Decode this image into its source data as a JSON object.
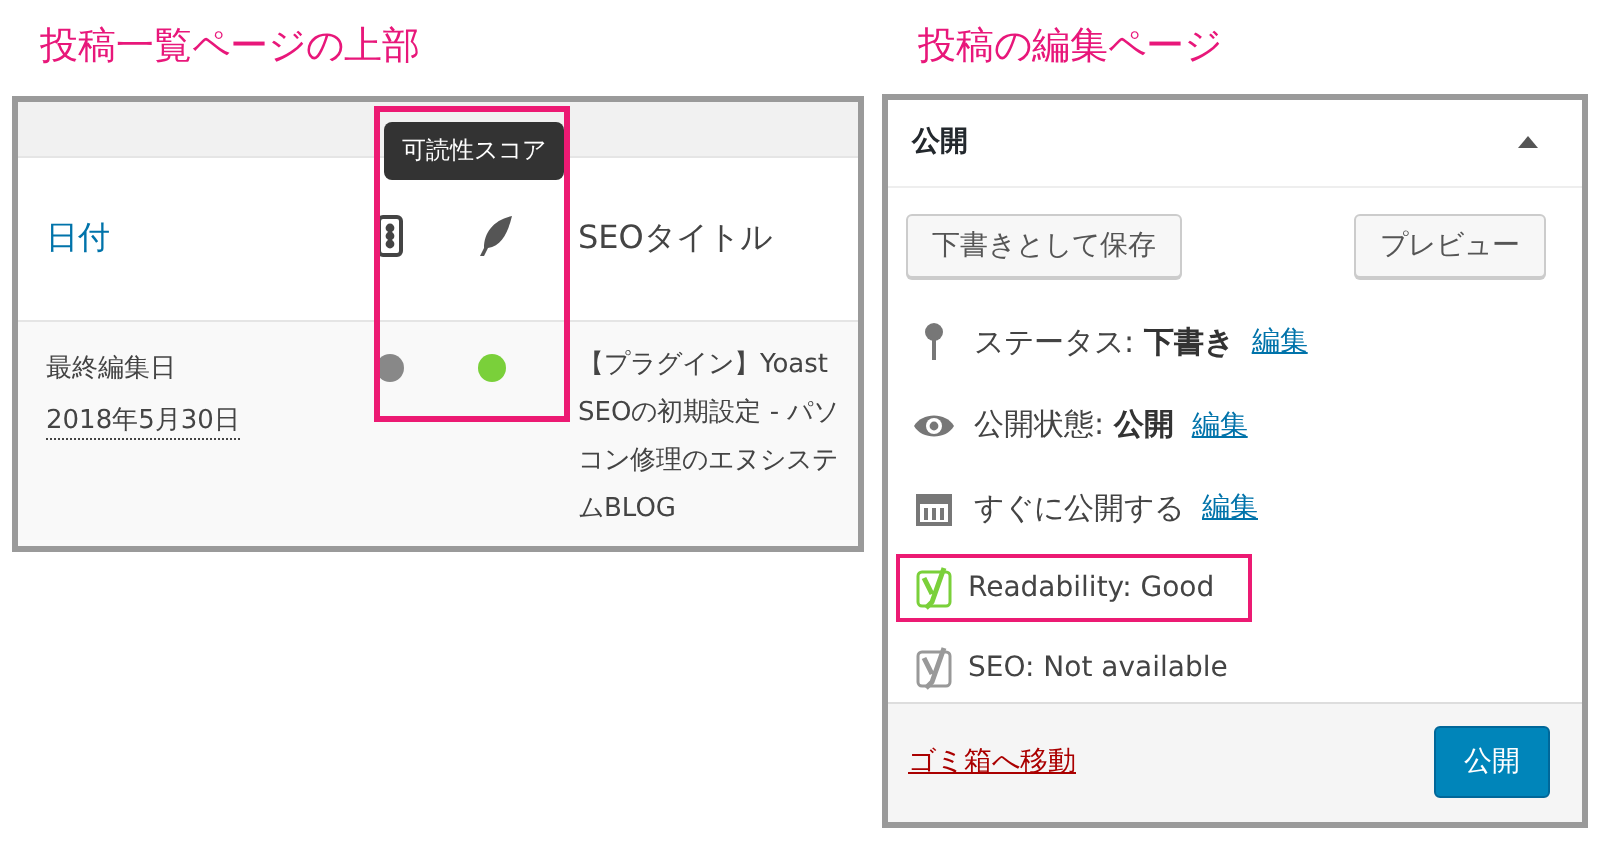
{
  "captions": [
    "投稿一覧ページの上部",
    "投稿の編集ページ"
  ],
  "post_list": {
    "tooltip": "可読性スコア",
    "columns": [
      {
        "kind": "text",
        "label": "日付"
      },
      {
        "kind": "seo-icon"
      },
      {
        "kind": "readability-icon"
      },
      {
        "kind": "text",
        "label": "SEOタイトル"
      }
    ],
    "rows": [
      {
        "date_label": "最終編集日",
        "date": "2018年5月30日",
        "score_dots": [
          {
            "color": "#888888"
          },
          {
            "color": "#7ad03a"
          }
        ],
        "seo_title": "【プラグイン】Yoast SEOの初期設定 - パソコン修理のエヌシステムBLOG"
      }
    ]
  },
  "publish_box": {
    "title": "公開",
    "buttons": [
      "下書きとして保存",
      "プレビュー"
    ],
    "items": [
      {
        "kind": "status",
        "label": "ステータス:",
        "value": "下書き",
        "link": "編集"
      },
      {
        "kind": "visibility",
        "label": "公開状態:",
        "value": "公開",
        "link": "編集"
      },
      {
        "kind": "schedule",
        "label": "すぐに公開する",
        "link": "編集"
      }
    ],
    "yoast": [
      {
        "label": "Readability: Good",
        "color": "#7ad03a",
        "highlighted": true
      },
      {
        "label": "SEO: Not available",
        "color": "#999999",
        "highlighted": false
      }
    ],
    "trash_link": "ゴミ箱へ移動",
    "publish_button": "公開"
  }
}
